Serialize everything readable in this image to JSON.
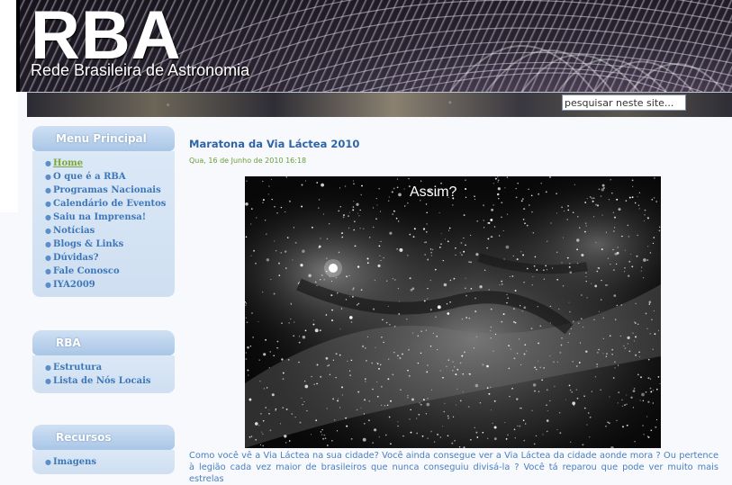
{
  "header": {
    "logo_text": "RBA",
    "site_name": "Rede Brasileira de Astronomia"
  },
  "search": {
    "value": "pesquisar neste site..."
  },
  "menu_principal": {
    "title": "Menu Principal",
    "items": [
      {
        "label": "Home",
        "active": true
      },
      {
        "label": "O que é a RBA"
      },
      {
        "label": "Programas Nacionais"
      },
      {
        "label": "Calendário de Eventos"
      },
      {
        "label": "Saiu na Imprensa!"
      },
      {
        "label": "Notícias"
      },
      {
        "label": "Blogs & Links"
      },
      {
        "label": "Dúvidas?"
      },
      {
        "label": "Fale Conosco"
      },
      {
        "label": "IYA2009"
      }
    ]
  },
  "rba_menu": {
    "title": "RBA",
    "items": [
      {
        "label": "Estrutura"
      },
      {
        "label": "Lista de Nós Locais"
      }
    ]
  },
  "recursos_menu": {
    "title": "Recursos",
    "items": [
      {
        "label": "Imagens"
      }
    ]
  },
  "article": {
    "title": "Maratona da Via Láctea 2010",
    "date": "Qua, 16 de Junho de 2010 16:18",
    "image_caption": "Assim?",
    "text": "Como você vê a Via Láctea na sua cidade? Você ainda consegue ver a Via Láctea da cidade aonde mora ? Ou pertence à legião cada vez maior de brasileiros que nunca conseguiu divisá-la ? Você tá reparou que pode ver muito mais estrelas"
  },
  "colors": {
    "link": "#3d77b9",
    "active_link": "#7ea637",
    "title": "#2f65a8",
    "date": "#67a033"
  }
}
